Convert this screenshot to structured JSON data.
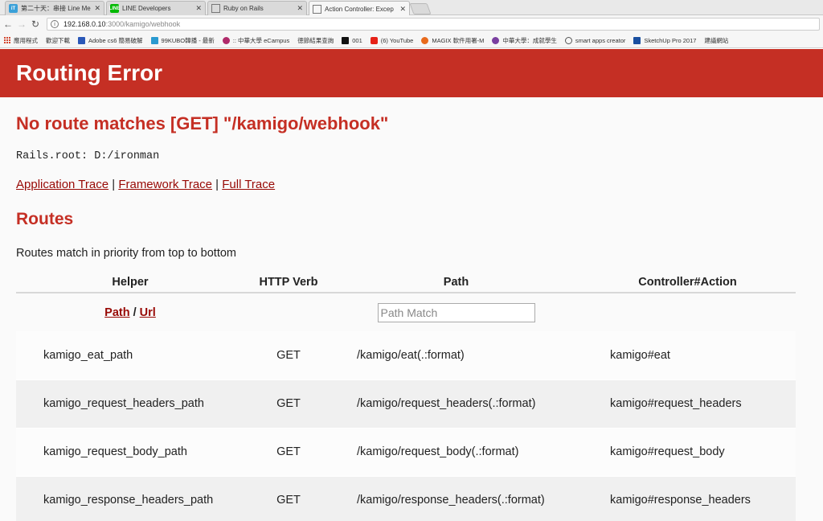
{
  "browser": {
    "tabs": [
      {
        "title": "第二十天：串接 Line Me",
        "favicon_color": "#3aa0d8",
        "active": false
      },
      {
        "title": "LINE Developers",
        "favicon_color": "#00b900",
        "active": false
      },
      {
        "title": "Ruby on Rails",
        "favicon_color": "#ffffff",
        "active": false
      },
      {
        "title": "Action Controller: Excep",
        "favicon_color": "#ffffff",
        "active": true
      }
    ],
    "url_host": "192.168.0.10",
    "url_rest": ":3000/kamigo/webhook",
    "bookmarks": [
      "應用程式",
      "歡迎下載",
      "Adobe cs6 簡易破解",
      "99KUBO韓播 - 最新",
      ":: 中華大學 eCampus",
      "徳節結果查詢",
      "001",
      "(6) YouTube",
      "MAGIX 軟件用署-M",
      "中華大學：成就學生",
      "smart apps creator",
      "SketchUp Pro 2017",
      "建議網站"
    ]
  },
  "page": {
    "header_title": "Routing Error",
    "error_message": "No route matches [GET] \"/kamigo/webhook\"",
    "rails_root": "Rails.root: D:/ironman",
    "trace_links": [
      "Application Trace",
      "Framework Trace",
      "Full Trace"
    ],
    "trace_separator": " | ",
    "routes_heading": "Routes",
    "routes_description": "Routes match in priority from top to bottom",
    "table": {
      "headers": [
        "Helper",
        "HTTP Verb",
        "Path",
        "Controller#Action"
      ],
      "path_link": "Path",
      "url_link": "Url",
      "slash": " / ",
      "path_match_placeholder": "Path Match",
      "rows": [
        {
          "helper": "kamigo_eat_path",
          "verb": "GET",
          "path": "/kamigo/eat(.:format)",
          "action": "kamigo#eat"
        },
        {
          "helper": "kamigo_request_headers_path",
          "verb": "GET",
          "path": "/kamigo/request_headers(.:format)",
          "action": "kamigo#request_headers"
        },
        {
          "helper": "kamigo_request_body_path",
          "verb": "GET",
          "path": "/kamigo/request_body(.:format)",
          "action": "kamigo#request_body"
        },
        {
          "helper": "kamigo_response_headers_path",
          "verb": "GET",
          "path": "/kamigo/response_headers(.:format)",
          "action": "kamigo#response_headers"
        }
      ]
    }
  }
}
